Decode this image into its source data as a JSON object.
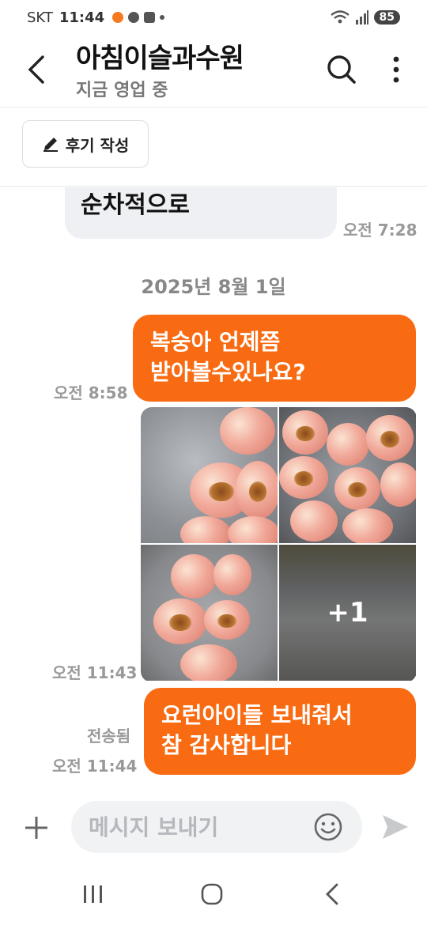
{
  "status_bar": {
    "carrier": "SKT",
    "time": "11:44",
    "battery": "85"
  },
  "header": {
    "title": "아침이슬과수원",
    "subtitle": "지금 영업 중"
  },
  "review_button": {
    "label": "후기 작성"
  },
  "messages": {
    "incoming_partial": {
      "line1": "순차적으로",
      "time": "오전 7:28"
    },
    "date_separator": "2025년 8월 1일",
    "outgoing_1": {
      "line1": "복숭아 언제쯤",
      "line2": "받아볼수있나요?",
      "time": "오전 8:58"
    },
    "photo_group": {
      "more_count": "+1",
      "time": "오전 11:43"
    },
    "outgoing_2": {
      "line1": "요런아이들 보내줘서",
      "line2": "참 감사합니다",
      "status": "전송됨",
      "time": "오전 11:44"
    }
  },
  "input": {
    "placeholder": "메시지 보내기",
    "value": ""
  },
  "colors": {
    "accent": "#f86b12",
    "incoming_bubble": "#eef0f3",
    "muted_text": "#999999"
  },
  "icons": [
    "back-arrow-icon",
    "search-icon",
    "more-vertical-icon",
    "pencil-icon",
    "plus-icon",
    "emoji-icon",
    "send-icon",
    "recent-apps-icon",
    "home-icon",
    "nav-back-icon"
  ]
}
